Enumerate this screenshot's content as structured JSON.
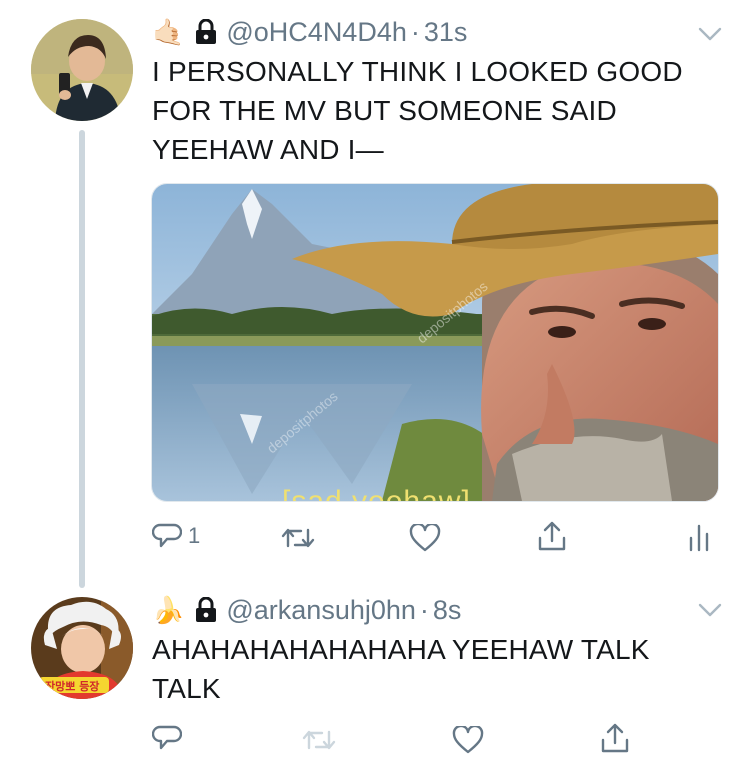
{
  "tweets": [
    {
      "emoji": "🤙🏻",
      "handle": "@oHC4N4D4h",
      "separator": "·",
      "time": "31s",
      "text": "I PERSONALLY THINK I LOOKED GOOD FOR THE MV BUT SOMEONE SAID YEEHAW AND I—",
      "media": {
        "caption": "[sad yeehaw]",
        "watermark": "depositphotos"
      },
      "actions": {
        "reply_count": "1"
      }
    },
    {
      "emoji": "🍌",
      "handle": "@arkansuhj0hn",
      "separator": "·",
      "time": "8s",
      "text": "AHAHAHAHAHAHAHA YEEHAW TALK TALK",
      "avatar_badge": "잔망뽀 등장"
    }
  ],
  "colors": {
    "text": "#14171a",
    "secondary": "#657786",
    "line": "#ccd6dd",
    "icon": "#1da1f2"
  },
  "icons": [
    "lock-icon",
    "chevron-down-icon",
    "reply-icon",
    "retweet-icon",
    "like-icon",
    "share-icon",
    "analytics-icon"
  ]
}
